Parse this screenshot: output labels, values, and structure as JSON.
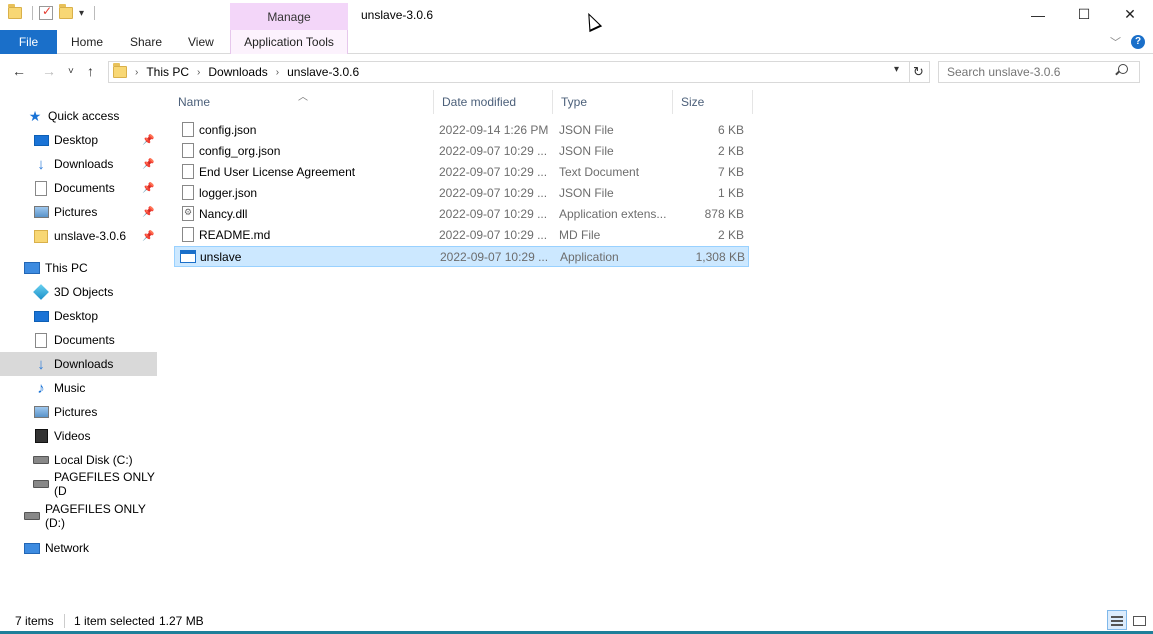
{
  "window": {
    "title": "unslave-3.0.6",
    "context_group": "Manage",
    "controls": {
      "minimize": "—",
      "maximize": "☐",
      "close": "✕"
    }
  },
  "ribbon": {
    "tabs": [
      "File",
      "Home",
      "Share",
      "View",
      "Application Tools"
    ],
    "file_color": "#1a6fc9",
    "manage_color": "#f3d6f9",
    "help": "?"
  },
  "address": {
    "breadcrumbs": [
      "This PC",
      "Downloads",
      "unslave-3.0.6"
    ],
    "search_placeholder": "Search unslave-3.0.6"
  },
  "nav_pane": {
    "items": [
      {
        "label": "Quick access",
        "icon": "star-icon"
      },
      {
        "label": "Desktop",
        "icon": "desktop-icon",
        "pinned": true
      },
      {
        "label": "Downloads",
        "icon": "download-icon",
        "pinned": true
      },
      {
        "label": "Documents",
        "icon": "documents-icon",
        "pinned": true
      },
      {
        "label": "Pictures",
        "icon": "pictures-icon",
        "pinned": true
      },
      {
        "label": "unslave-3.0.6",
        "icon": "folder-icon",
        "pinned": true
      },
      {
        "label": "This PC",
        "icon": "computer-icon"
      },
      {
        "label": "3D Objects",
        "icon": "3d-objects-icon"
      },
      {
        "label": "Desktop",
        "icon": "desktop-icon"
      },
      {
        "label": "Documents",
        "icon": "documents-icon"
      },
      {
        "label": "Downloads",
        "icon": "download-icon",
        "selected": true
      },
      {
        "label": "Music",
        "icon": "music-icon"
      },
      {
        "label": "Pictures",
        "icon": "pictures-icon"
      },
      {
        "label": "Videos",
        "icon": "videos-icon"
      },
      {
        "label": "Local Disk (C:)",
        "icon": "local-disk-icon"
      },
      {
        "label": "PAGEFILES ONLY (D",
        "icon": "drive-icon"
      },
      {
        "label": "PAGEFILES ONLY (D:)",
        "icon": "drive-icon"
      },
      {
        "label": "Network",
        "icon": "network-icon"
      }
    ]
  },
  "file_list": {
    "columns": [
      "Name",
      "Date modified",
      "Type",
      "Size"
    ],
    "rows": [
      {
        "name": "config.json",
        "date": "2022-09-14 1:26 PM",
        "type": "JSON File",
        "size": "6 KB",
        "icon": "file-icon"
      },
      {
        "name": "config_org.json",
        "date": "2022-09-07 10:29 ...",
        "type": "JSON File",
        "size": "2 KB",
        "icon": "file-icon"
      },
      {
        "name": "End User License Agreement",
        "date": "2022-09-07 10:29 ...",
        "type": "Text Document",
        "size": "7 KB",
        "icon": "text-file-icon"
      },
      {
        "name": "logger.json",
        "date": "2022-09-07 10:29 ...",
        "type": "JSON File",
        "size": "1 KB",
        "icon": "file-icon"
      },
      {
        "name": "Nancy.dll",
        "date": "2022-09-07 10:29 ...",
        "type": "Application extens...",
        "size": "878 KB",
        "icon": "dll-icon"
      },
      {
        "name": "README.md",
        "date": "2022-09-07 10:29 ...",
        "type": "MD File",
        "size": "2 KB",
        "icon": "file-icon"
      },
      {
        "name": "unslave",
        "date": "2022-09-07 10:29 ...",
        "type": "Application",
        "size": "1,308 KB",
        "icon": "application-icon",
        "selected": true
      }
    ]
  },
  "status": {
    "items_count": "7 items",
    "selection": "1 item selected",
    "selection_size": "1.27 MB"
  }
}
